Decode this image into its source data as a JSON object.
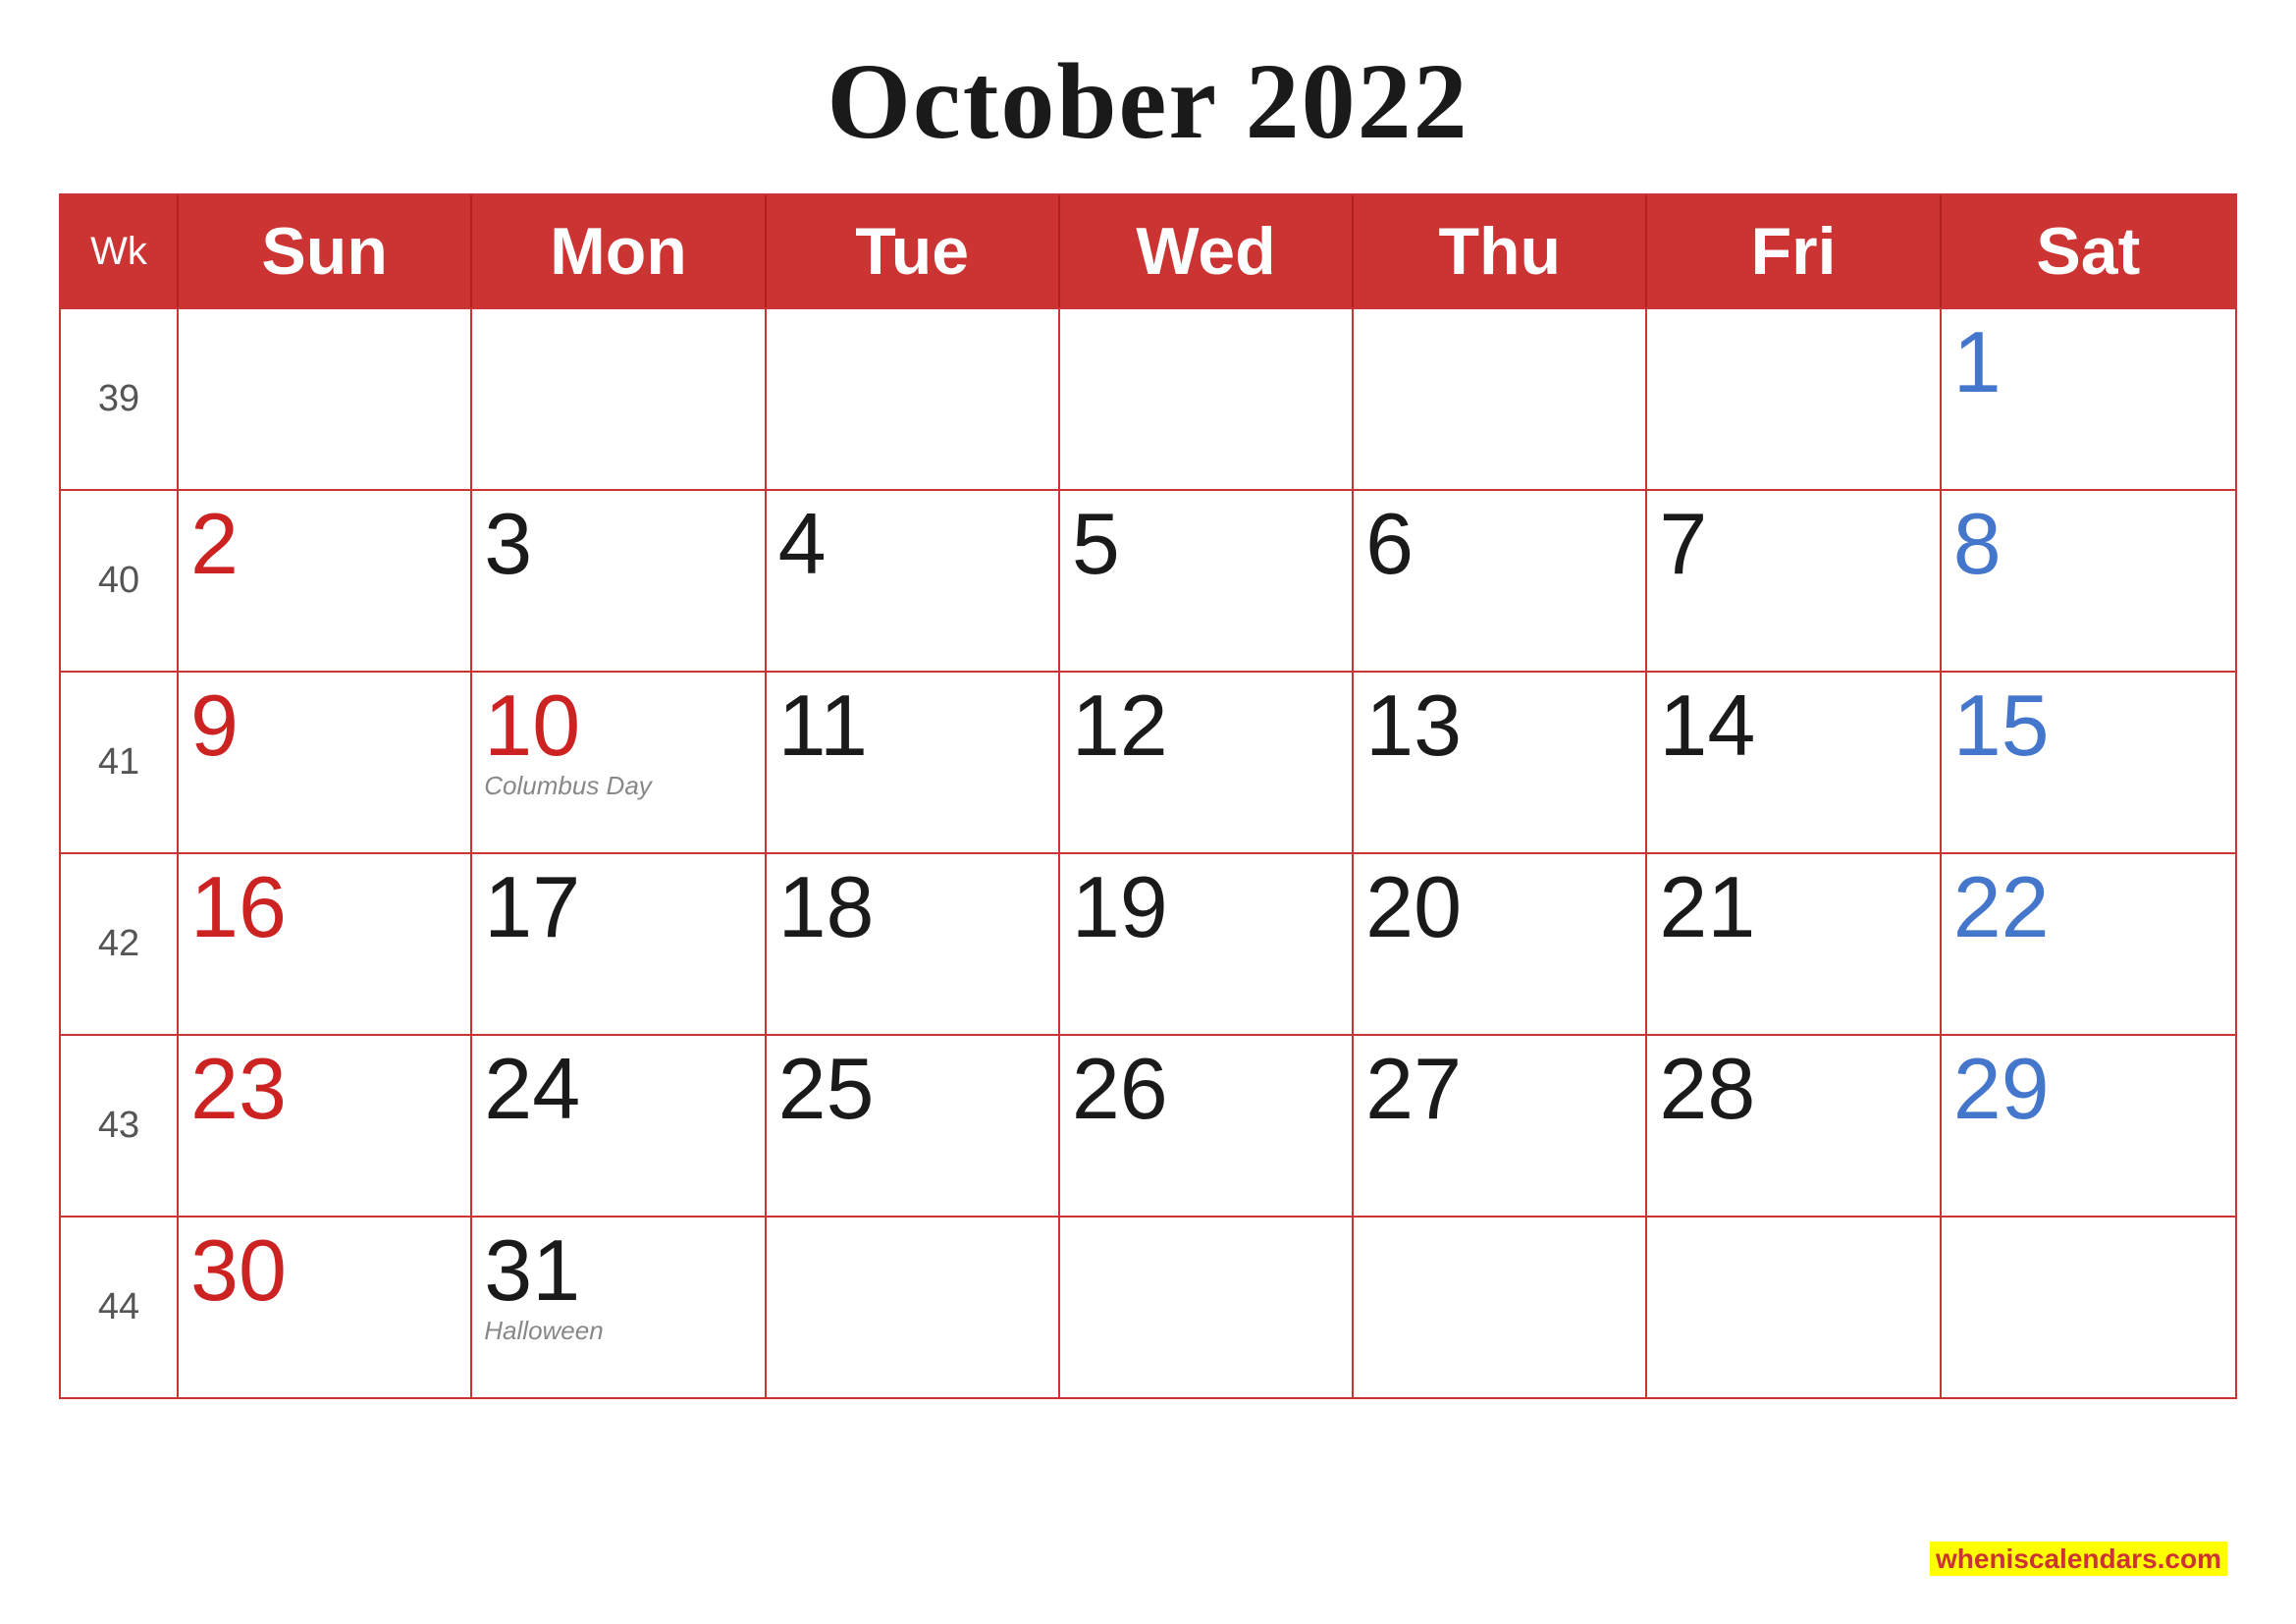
{
  "title": "October 2022",
  "header": {
    "wk": "Wk",
    "days": [
      "Sun",
      "Mon",
      "Tue",
      "Wed",
      "Thu",
      "Fri",
      "Sat"
    ]
  },
  "rows": [
    {
      "wk": "39",
      "cells": [
        {
          "day": "",
          "color": "black",
          "holiday": ""
        },
        {
          "day": "",
          "color": "black",
          "holiday": ""
        },
        {
          "day": "",
          "color": "black",
          "holiday": ""
        },
        {
          "day": "",
          "color": "black",
          "holiday": ""
        },
        {
          "day": "",
          "color": "black",
          "holiday": ""
        },
        {
          "day": "",
          "color": "black",
          "holiday": ""
        },
        {
          "day": "1",
          "color": "blue",
          "holiday": ""
        }
      ]
    },
    {
      "wk": "40",
      "cells": [
        {
          "day": "2",
          "color": "red",
          "holiday": ""
        },
        {
          "day": "3",
          "color": "black",
          "holiday": ""
        },
        {
          "day": "4",
          "color": "black",
          "holiday": ""
        },
        {
          "day": "5",
          "color": "black",
          "holiday": ""
        },
        {
          "day": "6",
          "color": "black",
          "holiday": ""
        },
        {
          "day": "7",
          "color": "black",
          "holiday": ""
        },
        {
          "day": "8",
          "color": "blue",
          "holiday": ""
        }
      ]
    },
    {
      "wk": "41",
      "cells": [
        {
          "day": "9",
          "color": "red",
          "holiday": ""
        },
        {
          "day": "10",
          "color": "red",
          "holiday": "Columbus Day"
        },
        {
          "day": "11",
          "color": "black",
          "holiday": ""
        },
        {
          "day": "12",
          "color": "black",
          "holiday": ""
        },
        {
          "day": "13",
          "color": "black",
          "holiday": ""
        },
        {
          "day": "14",
          "color": "black",
          "holiday": ""
        },
        {
          "day": "15",
          "color": "blue",
          "holiday": ""
        }
      ]
    },
    {
      "wk": "42",
      "cells": [
        {
          "day": "16",
          "color": "red",
          "holiday": ""
        },
        {
          "day": "17",
          "color": "black",
          "holiday": ""
        },
        {
          "day": "18",
          "color": "black",
          "holiday": ""
        },
        {
          "day": "19",
          "color": "black",
          "holiday": ""
        },
        {
          "day": "20",
          "color": "black",
          "holiday": ""
        },
        {
          "day": "21",
          "color": "black",
          "holiday": ""
        },
        {
          "day": "22",
          "color": "blue",
          "holiday": ""
        }
      ]
    },
    {
      "wk": "43",
      "cells": [
        {
          "day": "23",
          "color": "red",
          "holiday": ""
        },
        {
          "day": "24",
          "color": "black",
          "holiday": ""
        },
        {
          "day": "25",
          "color": "black",
          "holiday": ""
        },
        {
          "day": "26",
          "color": "black",
          "holiday": ""
        },
        {
          "day": "27",
          "color": "black",
          "holiday": ""
        },
        {
          "day": "28",
          "color": "black",
          "holiday": ""
        },
        {
          "day": "29",
          "color": "blue",
          "holiday": ""
        }
      ]
    },
    {
      "wk": "44",
      "cells": [
        {
          "day": "30",
          "color": "red",
          "holiday": ""
        },
        {
          "day": "31",
          "color": "black",
          "holiday": "Halloween"
        },
        {
          "day": "",
          "color": "black",
          "holiday": ""
        },
        {
          "day": "",
          "color": "black",
          "holiday": ""
        },
        {
          "day": "",
          "color": "black",
          "holiday": ""
        },
        {
          "day": "",
          "color": "black",
          "holiday": ""
        },
        {
          "day": "",
          "color": "black",
          "holiday": ""
        }
      ]
    }
  ],
  "watermark": {
    "when": "wheniscalendars",
    "rest": ".com"
  }
}
